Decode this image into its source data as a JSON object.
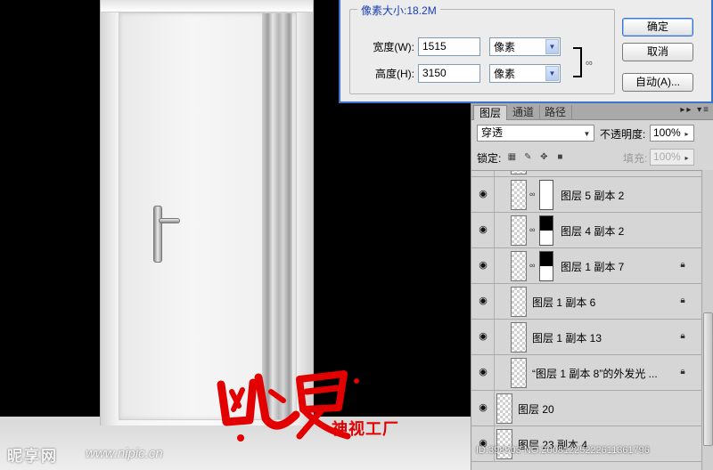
{
  "dialog": {
    "group_title": "像素大小:18.2M",
    "width_label": "宽度(W):",
    "width_value": "1515",
    "height_label": "高度(H):",
    "height_value": "3150",
    "width_unit": "像素",
    "height_unit": "像素",
    "ok_label": "确定",
    "cancel_label": "取消",
    "auto_label": "自动(A)..."
  },
  "layers_panel": {
    "tabs": [
      "图层",
      "通道",
      "路径"
    ],
    "blend_mode": "穿透",
    "opacity_label": "不透明度:",
    "opacity_value": "100%",
    "lock_label": "锁定:",
    "fill_label": "填充:",
    "fill_value": "100%",
    "layers": [
      {
        "name": "图层 5 副本 2",
        "mask": "white",
        "locked": false
      },
      {
        "name": "图层 4 副本 2",
        "mask": "half",
        "locked": false
      },
      {
        "name": "图层 1 副本 7",
        "mask": "half",
        "locked": true
      },
      {
        "name": "图层 1 副本 6",
        "mask": "none",
        "locked": true
      },
      {
        "name": "图层 1 副本 13",
        "mask": "none",
        "locked": true
      },
      {
        "name": "“图层 1 副本 8”的外发光 ...",
        "mask": "none",
        "locked": true
      },
      {
        "name": "图层 20",
        "mask": "none",
        "locked": false
      },
      {
        "name": "图层 23 副本 4",
        "mask": "none",
        "locked": false
      }
    ]
  },
  "watermark": {
    "brand_glyphs": "幽夏",
    "slogan": "神视工厂",
    "site_name": "昵享网",
    "site_url": "www.nipic.cn",
    "image_id": "ID:398503 NO:20081225222611361796"
  },
  "colors": {
    "accent": "#3b74c9",
    "logo_red": "#e30000",
    "panel_bg": "#d6d6d6"
  }
}
